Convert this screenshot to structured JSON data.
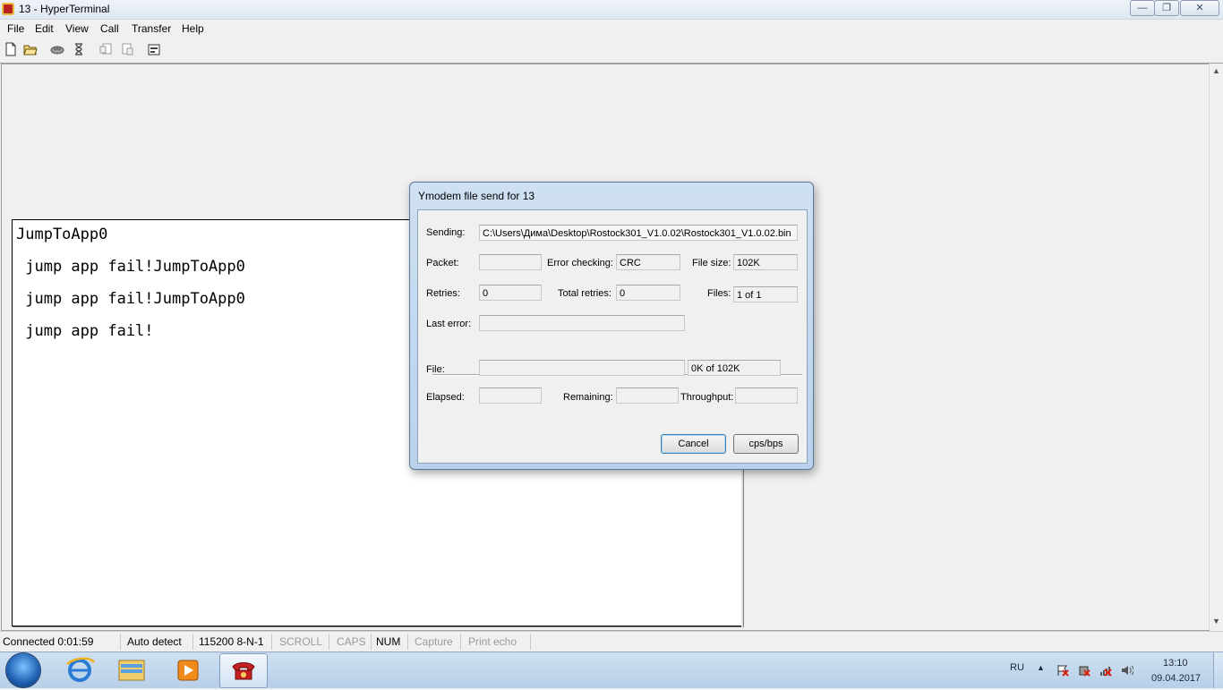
{
  "window": {
    "title": "13 - HyperTerminal"
  },
  "menu": [
    "File",
    "Edit",
    "View",
    "Call",
    "Transfer",
    "Help"
  ],
  "toolbar_icons": [
    "new-icon",
    "open-icon",
    "disconnect-icon",
    "dial-icon",
    "send-icon",
    "receive-icon",
    "properties-icon"
  ],
  "terminal": {
    "lines": [
      "JumpToApp0",
      " jump app fail!JumpToApp0",
      " jump app fail!JumpToApp0",
      " jump app fail!"
    ]
  },
  "dialog": {
    "title": "Ymodem file send for 13",
    "sending_label": "Sending:",
    "sending_value": "C:\\Users\\Дима\\Desktop\\Rostock301_V1.0.02\\Rostock301_V1.0.02.bin",
    "packet_label": "Packet:",
    "packet_value": "",
    "error_checking_label": "Error checking:",
    "error_checking_value": "CRC",
    "file_size_label": "File size:",
    "file_size_value": "102K",
    "retries_label": "Retries:",
    "retries_value": "0",
    "total_retries_label": "Total retries:",
    "total_retries_value": "0",
    "files_label": "Files:",
    "files_value": "1 of 1",
    "last_error_label": "Last error:",
    "last_error_value": "",
    "file_label": "File:",
    "file_progress": 0,
    "file_progress_text": "0K of 102K",
    "elapsed_label": "Elapsed:",
    "elapsed_value": "",
    "remaining_label": "Remaining:",
    "remaining_value": "",
    "throughput_label": "Throughput:",
    "throughput_value": "",
    "cancel_label": "Cancel",
    "cpsbps_label": "cps/bps"
  },
  "statusbar": {
    "connected": "Connected 0:01:59",
    "detect": "Auto detect",
    "port": "115200 8-N-1",
    "scroll": "SCROLL",
    "caps": "CAPS",
    "num": "NUM",
    "capture": "Capture",
    "print_echo": "Print echo"
  },
  "taskbar": {
    "language": "RU",
    "time": "13:10",
    "date": "09.04.2017"
  },
  "colors": {
    "terminal_bg": "#ffffff",
    "dialog_frame": "#b9d1ea",
    "taskbar": "#b7cfe8"
  }
}
